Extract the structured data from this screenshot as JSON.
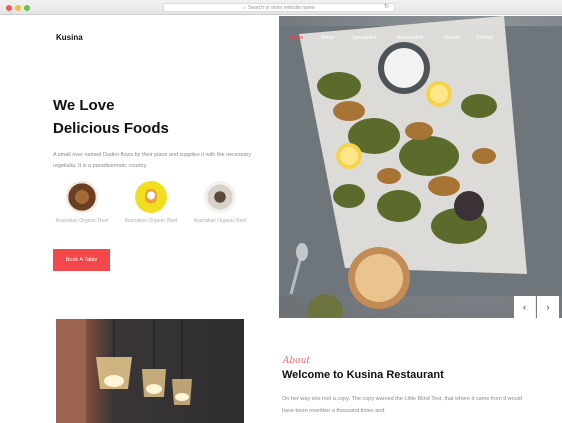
{
  "browser": {
    "url_placeholder": "Search or enter website name",
    "icons": [
      "close-dot",
      "minimize-dot",
      "maximize-dot",
      "search-icon",
      "reload-icon"
    ]
  },
  "brand": "Kusina",
  "nav": {
    "items": [
      "Home",
      "About",
      "Specialties",
      "Reservation",
      "Stories",
      "Contact"
    ],
    "active": "Home"
  },
  "hero": {
    "title_line1": "We Love",
    "title_line2": "Delicious Foods",
    "text": "A small river named Duden flows by their place and supplies it with the necessary regelialia. It is a paradisematic country.",
    "features": [
      {
        "label": "Australian Organic Beef"
      },
      {
        "label": "Australian Organic Beef"
      },
      {
        "label": "Australian Organic Beef"
      }
    ],
    "cta_label": "Book A Table"
  },
  "slider": {
    "prev_label": "‹",
    "next_label": "›"
  },
  "about": {
    "script": "About",
    "title": "Welcome to Kusina Restaurant",
    "text": "On her way she met a copy. The copy warned the Little Blind Text, that where it came from it would have been rewritten a thousand times and"
  },
  "colors": {
    "accent": "#f2484a",
    "text": "#111111",
    "muted": "#8a8a8a"
  }
}
